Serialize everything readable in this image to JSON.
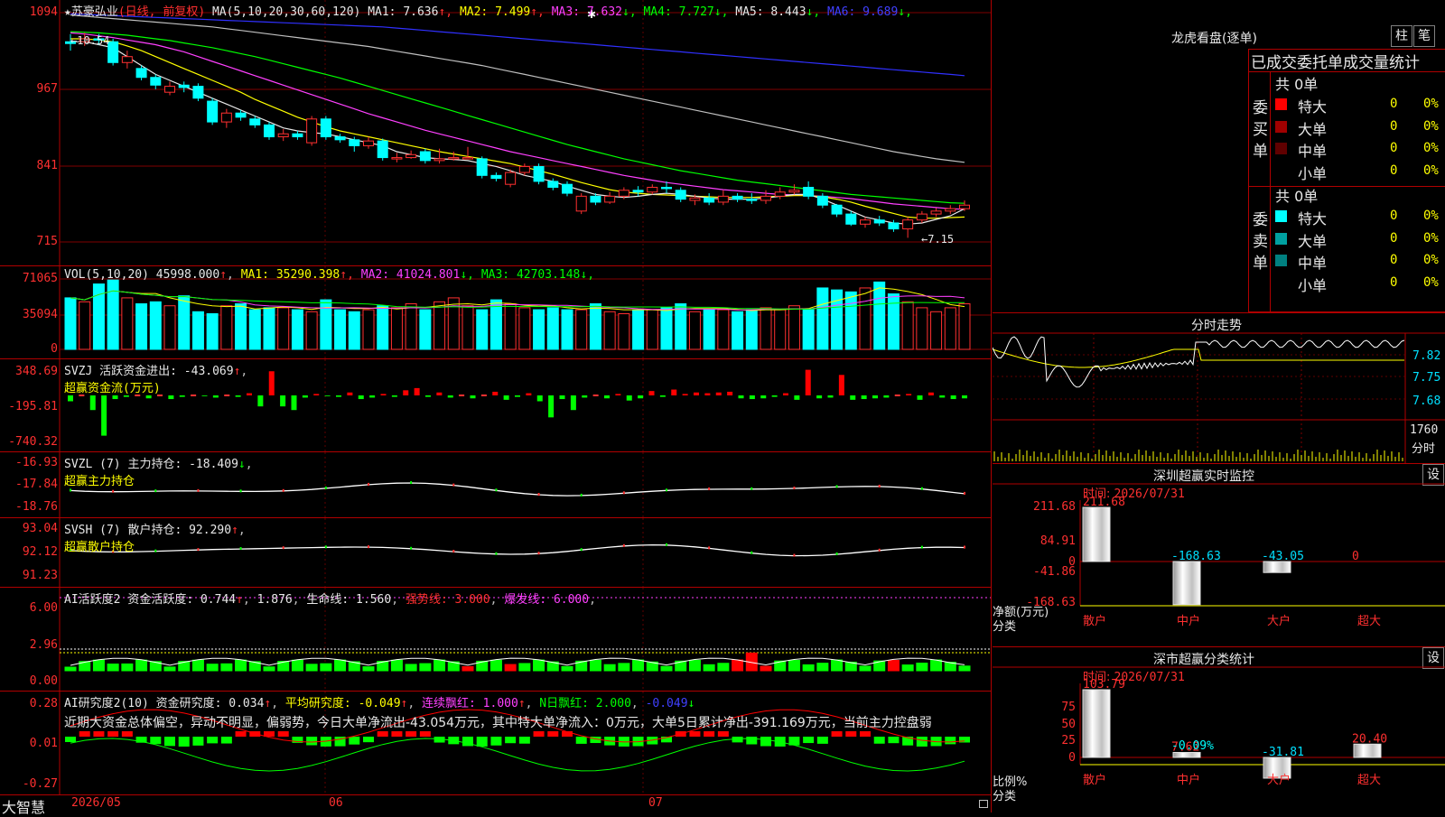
{
  "stock": {
    "name": "苏豪弘业",
    "mode": "(日线, 前复权)"
  },
  "kline": {
    "ma_label": "MA(5,10,20,30,60,120)",
    "ma": [
      {
        "n": "MA1:",
        "v": "7.636",
        "a": "↑",
        "c": "#e8e8e8"
      },
      {
        "n": "MA2:",
        "v": "7.499",
        "a": "↑",
        "c": "#ffff00"
      },
      {
        "n": "MA3:",
        "v": "7.632",
        "a": "↓",
        "c": "#ff40ff"
      },
      {
        "n": "MA4:",
        "v": "7.727",
        "a": "↓",
        "c": "#00ff00"
      },
      {
        "n": "MA5:",
        "v": "8.443",
        "a": "↓",
        "c": "#e8e8e8"
      },
      {
        "n": "MA6:",
        "v": "9.689",
        "a": "↓",
        "c": "#4040ff"
      }
    ],
    "yticks": [
      "1094",
      "967",
      "841",
      "715"
    ],
    "hi_label": "←10.54",
    "lo_label": "←7.15",
    "colors": {
      "up": "#ff3030",
      "down": "#00ffff",
      "ma5": "#e8e8e8",
      "ma10": "#ffff00",
      "ma20": "#ff40ff",
      "ma30": "#00ff00",
      "ma60": "#c0c0c0",
      "ma120": "#3030ff"
    },
    "candles": [
      [
        10.45,
        10.42,
        10.58,
        10.3
      ],
      [
        10.45,
        10.5,
        10.6,
        10.38
      ],
      [
        10.5,
        10.48,
        10.58,
        10.4
      ],
      [
        10.45,
        10.1,
        10.5,
        10.05
      ],
      [
        10.1,
        10.2,
        10.3,
        10.0
      ],
      [
        10.0,
        9.85,
        10.05,
        9.8
      ],
      [
        9.85,
        9.72,
        9.9,
        9.65
      ],
      [
        9.6,
        9.7,
        9.78,
        9.55
      ],
      [
        9.72,
        9.68,
        9.78,
        9.6
      ],
      [
        9.7,
        9.5,
        9.75,
        9.45
      ],
      [
        9.45,
        9.1,
        9.5,
        9.05
      ],
      [
        9.1,
        9.25,
        9.32,
        9.0
      ],
      [
        9.25,
        9.18,
        9.3,
        9.12
      ],
      [
        9.15,
        9.05,
        9.2,
        9.0
      ],
      [
        9.05,
        8.85,
        9.1,
        8.8
      ],
      [
        8.85,
        8.9,
        8.98,
        8.78
      ],
      [
        8.9,
        8.85,
        8.95,
        8.8
      ],
      [
        8.75,
        9.15,
        9.2,
        8.7
      ],
      [
        9.15,
        8.85,
        9.2,
        8.8
      ],
      [
        8.85,
        8.8,
        8.9,
        8.75
      ],
      [
        8.8,
        8.7,
        8.85,
        8.6
      ],
      [
        8.7,
        8.78,
        8.85,
        8.65
      ],
      [
        8.78,
        8.5,
        8.82,
        8.45
      ],
      [
        8.5,
        8.5,
        8.58,
        8.42
      ],
      [
        8.5,
        8.55,
        8.62,
        8.48
      ],
      [
        8.6,
        8.45,
        8.65,
        8.4
      ],
      [
        8.45,
        8.48,
        8.65,
        8.4
      ],
      [
        8.48,
        8.5,
        8.6,
        8.45
      ],
      [
        8.5,
        8.5,
        8.68,
        8.48
      ],
      [
        8.48,
        8.2,
        8.52,
        8.15
      ],
      [
        8.2,
        8.15,
        8.25,
        8.1
      ],
      [
        8.05,
        8.25,
        8.3,
        8.0
      ],
      [
        8.25,
        8.35,
        8.4,
        8.2
      ],
      [
        8.35,
        8.1,
        8.4,
        8.05
      ],
      [
        8.1,
        8.0,
        8.15,
        7.95
      ],
      [
        8.05,
        7.9,
        8.1,
        7.85
      ],
      [
        7.6,
        7.85,
        7.9,
        7.55
      ],
      [
        7.85,
        7.75,
        7.9,
        7.7
      ],
      [
        7.75,
        7.85,
        7.92,
        7.72
      ],
      [
        7.85,
        7.95,
        8.0,
        7.8
      ],
      [
        7.95,
        7.92,
        8.02,
        7.85
      ],
      [
        7.92,
        8.0,
        8.05,
        7.88
      ],
      [
        8.0,
        7.98,
        8.1,
        7.9
      ],
      [
        7.95,
        7.8,
        8.0,
        7.75
      ],
      [
        7.78,
        7.82,
        7.88,
        7.7
      ],
      [
        7.82,
        7.75,
        7.9,
        7.7
      ],
      [
        7.75,
        7.85,
        7.95,
        7.7
      ],
      [
        7.85,
        7.8,
        7.9,
        7.75
      ],
      [
        7.8,
        7.78,
        7.9,
        7.72
      ],
      [
        7.78,
        7.85,
        7.95,
        7.72
      ],
      [
        7.85,
        7.92,
        8.0,
        7.8
      ],
      [
        7.92,
        7.95,
        8.05,
        7.88
      ],
      [
        8.0,
        7.85,
        8.1,
        7.8
      ],
      [
        7.85,
        7.7,
        7.9,
        7.65
      ],
      [
        7.7,
        7.55,
        7.72,
        7.5
      ],
      [
        7.55,
        7.38,
        7.6,
        7.35
      ],
      [
        7.38,
        7.45,
        7.5,
        7.32
      ],
      [
        7.45,
        7.4,
        7.52,
        7.35
      ],
      [
        7.4,
        7.3,
        7.45,
        7.25
      ],
      [
        7.3,
        7.45,
        7.5,
        7.15
      ],
      [
        7.45,
        7.55,
        7.6,
        7.4
      ],
      [
        7.55,
        7.6,
        7.65,
        7.5
      ],
      [
        7.6,
        7.64,
        7.7,
        7.55
      ],
      [
        7.64,
        7.7,
        7.78,
        7.6
      ]
    ],
    "ma_series": {
      "ma5": [
        10.45,
        10.45,
        10.4,
        10.35,
        10.2,
        10.05,
        9.9,
        9.8,
        9.7,
        9.6,
        9.5,
        9.4,
        9.3,
        9.2,
        9.1,
        9.0,
        8.95,
        8.92,
        8.9,
        8.85,
        8.8,
        8.75,
        8.7,
        8.6,
        8.55,
        8.5,
        8.48,
        8.47,
        8.45,
        8.4,
        8.35,
        8.28,
        8.2,
        8.15,
        8.1,
        8.02,
        7.95,
        7.88,
        7.85,
        7.83,
        7.85,
        7.88,
        7.9,
        7.88,
        7.85,
        7.82,
        7.8,
        7.8,
        7.8,
        7.82,
        7.85,
        7.88,
        7.88,
        7.8,
        7.7,
        7.6,
        7.5,
        7.45,
        7.4,
        7.38,
        7.4,
        7.46,
        7.52,
        7.64
      ],
      "ma10": [
        10.5,
        10.5,
        10.48,
        10.45,
        10.38,
        10.3,
        10.2,
        10.1,
        10.0,
        9.9,
        9.8,
        9.7,
        9.6,
        9.48,
        9.38,
        9.28,
        9.18,
        9.1,
        9.02,
        8.95,
        8.9,
        8.85,
        8.8,
        8.75,
        8.7,
        8.65,
        8.6,
        8.56,
        8.52,
        8.48,
        8.44,
        8.4,
        8.34,
        8.28,
        8.22,
        8.15,
        8.08,
        8.02,
        7.96,
        7.92,
        7.9,
        7.88,
        7.87,
        7.86,
        7.85,
        7.84,
        7.83,
        7.83,
        7.83,
        7.84,
        7.85,
        7.86,
        7.86,
        7.84,
        7.8,
        7.75,
        7.68,
        7.62,
        7.56,
        7.5,
        7.48,
        7.48,
        7.49,
        7.5
      ],
      "ma20": [
        10.6,
        10.58,
        10.55,
        10.52,
        10.48,
        10.44,
        10.4,
        10.34,
        10.28,
        10.2,
        10.12,
        10.04,
        9.96,
        9.88,
        9.8,
        9.72,
        9.64,
        9.56,
        9.48,
        9.4,
        9.32,
        9.24,
        9.17,
        9.1,
        9.03,
        8.96,
        8.9,
        8.84,
        8.78,
        8.72,
        8.66,
        8.6,
        8.55,
        8.5,
        8.45,
        8.4,
        8.35,
        8.3,
        8.25,
        8.2,
        8.16,
        8.12,
        8.08,
        8.05,
        8.02,
        7.99,
        7.96,
        7.94,
        7.92,
        7.9,
        7.88,
        7.87,
        7.86,
        7.85,
        7.83,
        7.81,
        7.78,
        7.75,
        7.72,
        7.7,
        7.68,
        7.66,
        7.64,
        7.63
      ],
      "ma30": [
        10.62,
        10.61,
        10.6,
        10.58,
        10.56,
        10.53,
        10.5,
        10.47,
        10.43,
        10.39,
        10.35,
        10.3,
        10.25,
        10.2,
        10.14,
        10.08,
        10.02,
        9.96,
        9.9,
        9.84,
        9.77,
        9.7,
        9.63,
        9.56,
        9.49,
        9.42,
        9.35,
        9.28,
        9.21,
        9.14,
        9.07,
        9.0,
        8.93,
        8.86,
        8.79,
        8.72,
        8.66,
        8.6,
        8.54,
        8.48,
        8.43,
        8.38,
        8.33,
        8.28,
        8.24,
        8.2,
        8.16,
        8.12,
        8.09,
        8.06,
        8.03,
        8.0,
        7.97,
        7.94,
        7.91,
        7.88,
        7.86,
        7.84,
        7.82,
        7.8,
        7.78,
        7.76,
        7.74,
        7.73
      ],
      "ma60": [
        10.9,
        10.88,
        10.86,
        10.84,
        10.82,
        10.8,
        10.78,
        10.76,
        10.74,
        10.72,
        10.7,
        10.67,
        10.64,
        10.61,
        10.58,
        10.55,
        10.52,
        10.49,
        10.46,
        10.43,
        10.4,
        10.37,
        10.33,
        10.29,
        10.25,
        10.21,
        10.17,
        10.13,
        10.09,
        10.05,
        10.0,
        9.95,
        9.9,
        9.85,
        9.8,
        9.75,
        9.7,
        9.65,
        9.6,
        9.55,
        9.5,
        9.45,
        9.4,
        9.35,
        9.3,
        9.25,
        9.2,
        9.15,
        9.1,
        9.05,
        9.0,
        8.95,
        8.9,
        8.85,
        8.8,
        8.75,
        8.7,
        8.65,
        8.6,
        8.56,
        8.52,
        8.48,
        8.45,
        8.42
      ],
      "ma120": [
        10.92,
        10.91,
        10.9,
        10.89,
        10.88,
        10.87,
        10.86,
        10.85,
        10.84,
        10.83,
        10.82,
        10.81,
        10.8,
        10.79,
        10.78,
        10.77,
        10.76,
        10.75,
        10.74,
        10.73,
        10.72,
        10.71,
        10.7,
        10.68,
        10.66,
        10.64,
        10.62,
        10.6,
        10.58,
        10.56,
        10.54,
        10.52,
        10.5,
        10.48,
        10.46,
        10.44,
        10.42,
        10.4,
        10.38,
        10.36,
        10.34,
        10.32,
        10.3,
        10.28,
        10.26,
        10.24,
        10.22,
        10.2,
        10.18,
        10.16,
        10.14,
        10.12,
        10.1,
        10.08,
        10.06,
        10.04,
        10.02,
        10.0,
        9.98,
        9.96,
        9.94,
        9.92,
        9.9,
        9.88
      ]
    }
  },
  "vol": {
    "label": "VOL(5,10,20)",
    "value": "45998.000",
    "va": "↑",
    "ma": [
      {
        "n": "MA1:",
        "v": "35290.398",
        "a": "↑",
        "c": "#ffff00"
      },
      {
        "n": "MA2:",
        "v": "41024.801",
        "a": "↓",
        "c": "#ff40ff"
      },
      {
        "n": "MA3:",
        "v": "42703.148",
        "a": "↓",
        "c": "#00ff00"
      }
    ],
    "yticks": [
      "71065",
      "35094",
      "0"
    ],
    "bars": [
      52000,
      48000,
      66000,
      70000,
      52000,
      46000,
      48000,
      44000,
      54000,
      38000,
      36000,
      44000,
      46000,
      40000,
      42000,
      42000,
      40000,
      38000,
      50000,
      40000,
      38000,
      40000,
      44000,
      42000,
      46000,
      40000,
      48000,
      52000,
      44000,
      40000,
      50000,
      46000,
      42000,
      40000,
      42000,
      40000,
      40000,
      46000,
      38000,
      36000,
      40000,
      40000,
      42000,
      46000,
      38000,
      40000,
      40000,
      38000,
      40000,
      42000,
      40000,
      44000,
      40000,
      62000,
      60000,
      58000,
      62000,
      68000,
      56000,
      48000,
      42000,
      38000,
      42000,
      46000
    ]
  },
  "svzj": {
    "label": "SVZJ",
    "title": "活跃资金进出:",
    "value": "-43.069",
    "arrow": "↑",
    "sub": "超赢资金流(万元)",
    "yticks": [
      "348.69",
      "-195.81",
      "-740.32"
    ],
    "bars": [
      -80,
      0,
      -200,
      -550,
      -50,
      -20,
      0,
      -40,
      0,
      -50,
      -20,
      0,
      -10,
      -30,
      0,
      -20,
      30,
      -150,
      330,
      -150,
      -200,
      -30,
      20,
      -10,
      -20,
      40,
      -50,
      -30,
      20,
      -20,
      70,
      100,
      -20,
      40,
      -30,
      0,
      -40,
      0,
      50,
      -60,
      -20,
      30,
      -80,
      -300,
      -50,
      -200,
      -30,
      0,
      -40,
      20,
      -70,
      -40,
      60,
      -20,
      80,
      20,
      40,
      30,
      40,
      50,
      -40,
      -50,
      -40,
      -20,
      30,
      -60,
      350,
      -40,
      -30,
      280,
      -60,
      -50,
      -40,
      -30,
      0,
      20,
      -60,
      40,
      -30,
      -50,
      -40
    ]
  },
  "svzl": {
    "label": "SVZL (7)",
    "title": "主力持仓:",
    "value": "-18.409",
    "arrow": "↓",
    "sub": "超赢主力持仓",
    "yticks": [
      "-16.93",
      "-17.84",
      "-18.76"
    ]
  },
  "svsh": {
    "label": "SVSH (7)",
    "title": "散户持仓:",
    "value": "92.290",
    "arrow": "↑",
    "sub": "超赢散户持仓",
    "yticks": [
      "93.04",
      "92.12",
      "91.23"
    ]
  },
  "ai1": {
    "label": "AI活跃度2",
    "title": "资金活跃度:",
    "v1": "0.744",
    "a1": "↑",
    "v2": "1.876",
    "lbl2": "生命线:",
    "v3": "1.560",
    "lbl3": "强势线:",
    "v4": "3.000",
    "lbl4": "爆发线:",
    "v5": "6.000",
    "yticks": [
      "6.00",
      "2.96",
      "0.00"
    ]
  },
  "ai2": {
    "label": "AI研究度2(10)",
    "title": "资金研究度:",
    "v1": "0.034",
    "a1": "↑",
    "lbl2": "平均研究度:",
    "v2": "-0.049",
    "a2": "↑",
    "lbl3": "连续飘红:",
    "v3": "1.000",
    "a3": "↑",
    "lbl4": "N日飘红:",
    "v4": "2.000",
    "v5": "-0.049",
    "a5": "↓",
    "comment": "近期大资金总体偏空，异动不明显，偏弱势，今日大单净流出-43.054万元，其中特大单净流入：0万元，大单5日累计净出-391.169万元，当前主力控盘弱",
    "yticks": [
      "0.28",
      "0.01",
      "-0.27"
    ]
  },
  "xaxis": {
    "labels": [
      "2026/05",
      "06",
      "07"
    ]
  },
  "brand": "大智慧",
  "right": {
    "lhb_title": "龙虎看盘(逐单)",
    "btn1": "柱",
    "btn2": "笔",
    "stat_title": "已成交委托单成交量统计",
    "buy": {
      "side": "委买单",
      "total": "共 0单",
      "rows": [
        {
          "label": "特大",
          "n": "0",
          "p": "0%",
          "c": "#ff0000"
        },
        {
          "label": "大单",
          "n": "0",
          "p": "0%",
          "c": "#a00000"
        },
        {
          "label": "中单",
          "n": "0",
          "p": "0%",
          "c": "#600000"
        },
        {
          "label": "小单",
          "n": "0",
          "p": "0%",
          "c": "#000000"
        }
      ]
    },
    "sell": {
      "side": "委卖单",
      "total": "共 0单",
      "rows": [
        {
          "label": "特大",
          "n": "0",
          "p": "0%",
          "c": "#00ffff"
        },
        {
          "label": "大单",
          "n": "0",
          "p": "0%",
          "c": "#00a0a0"
        },
        {
          "label": "中单",
          "n": "0",
          "p": "0%",
          "c": "#008080"
        },
        {
          "label": "小单",
          "n": "0",
          "p": "0%",
          "c": "#000000"
        }
      ]
    },
    "intraday": {
      "title": "分时走势",
      "yticks": [
        "7.82",
        "7.75",
        "7.68"
      ],
      "vol_tick": "1760",
      "vol_unit": "分时"
    },
    "monitor": {
      "title": "深圳超赢实时监控",
      "set": "设",
      "time_label": "时间:",
      "time": "2026/07/31",
      "yticks": [
        "211.68",
        "84.91",
        "0",
        "-41.86",
        "-168.63"
      ],
      "unit": "净额(万元)",
      "cat_label": "分类",
      "cats": [
        {
          "name": "散户",
          "value": 211.68,
          "label": "211.68"
        },
        {
          "name": "中户",
          "value": -168.63,
          "label": "-168.63"
        },
        {
          "name": "大户",
          "value": -43.05,
          "label": "-43.05"
        },
        {
          "name": "超大",
          "value": 0,
          "label": "0"
        }
      ]
    },
    "classify": {
      "title": "深市超赢分类统计",
      "set": "设",
      "time_label": "时间:",
      "time": "2026/07/31",
      "yticks": [
        "75",
        "50",
        "25",
        "0"
      ],
      "unit": "比例%",
      "cat_label": "分类",
      "cats": [
        {
          "name": "散户",
          "value": 103.79,
          "label": "103.79"
        },
        {
          "name": "中户",
          "value": 7.62,
          "label": "7.62",
          "sub": "-0.09%"
        },
        {
          "name": "大户",
          "value": -31.81,
          "label": "-31.81"
        },
        {
          "name": "超大",
          "value": 20.4,
          "label": "20.40"
        }
      ]
    }
  }
}
